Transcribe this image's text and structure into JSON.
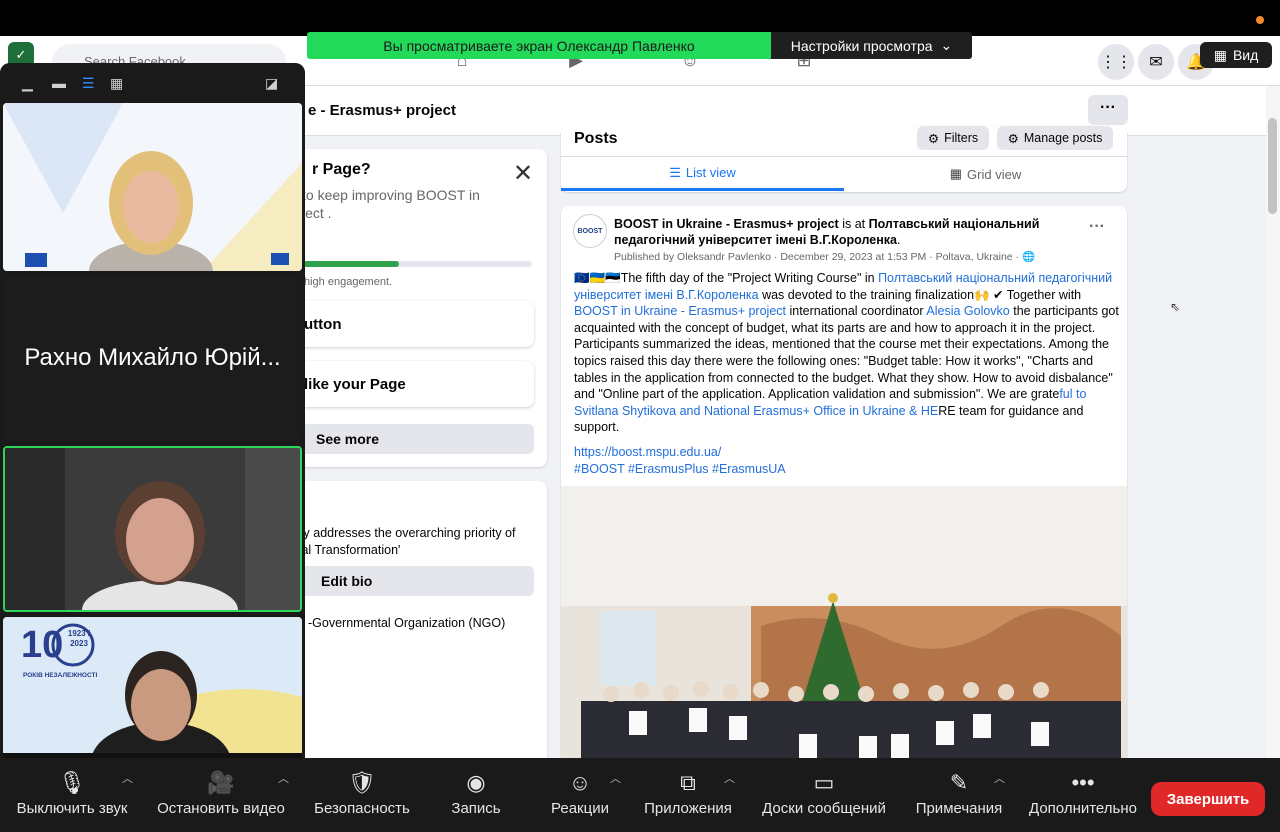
{
  "zoom": {
    "share_banner": "Вы просматриваете экран Олександр Павленко",
    "view_settings": "Настройки просмотра",
    "view_button": "Вид",
    "participants": [
      {
        "kind": "video",
        "desc": ""
      },
      {
        "kind": "name",
        "name": "Рахно Михайло Юрій..."
      },
      {
        "kind": "video",
        "desc": ""
      },
      {
        "kind": "video",
        "desc": "",
        "badge_years": "1923 / 2023",
        "badge_text": "РОКІВ НЕЗАЛЕЖНОСТІ"
      }
    ],
    "toolbar": [
      {
        "label": "Выключить звук",
        "icon": "microphone-icon",
        "glyph": "🎙"
      },
      {
        "label": "Остановить видео",
        "icon": "camera-icon",
        "glyph": "🎥"
      },
      {
        "label": "Безопасность",
        "icon": "shield-icon",
        "glyph": "🛡"
      },
      {
        "label": "Запись",
        "icon": "record-icon",
        "glyph": "◉"
      },
      {
        "label": "Реакции",
        "icon": "smile-icon",
        "glyph": "☺"
      },
      {
        "label": "Приложения",
        "icon": "apps-icon",
        "glyph": "⧉"
      },
      {
        "label": "Доски сообщений",
        "icon": "whiteboard-icon",
        "glyph": "▭"
      },
      {
        "label": "Примечания",
        "icon": "notes-icon",
        "glyph": "✎"
      },
      {
        "label": "Дополнительно",
        "icon": "more-icon",
        "glyph": "•••"
      }
    ],
    "end_button": "Завершить"
  },
  "facebook": {
    "search_placeholder": "Search Facebook",
    "page_title": "e - Erasmus+ project",
    "more": "···",
    "left_card1": {
      "title": "r Page?",
      "text": "to keep improving BOOST in\nject .",
      "engagement": "high engagement.",
      "row1": "utton",
      "row2": "like your Page",
      "see_more": "See more"
    },
    "left_card2": {
      "text": "ily addresses the overarching priority of\ntal Transformation'",
      "edit_bio": "Edit bio",
      "category": "-Governmental Organization (NGO)"
    },
    "posts": {
      "title": "Posts",
      "filters": "Filters",
      "manage": "Manage posts",
      "list_view": "List view",
      "grid_view": "Grid view"
    },
    "post": {
      "avatar_text": "BOOST",
      "author": "BOOST in Ukraine - Erasmus+ project",
      "is_at": " is at ",
      "place": "Полтавський національний педагогічний університет імені В.Г.Короленка",
      "meta": "Published by Oleksandr Pavlenko · December 29, 2023 at 1:53 PM · Poltava, Ukraine ·",
      "p1": "🇪🇺🇺🇦🇪🇪The fifth day of the \"Project Writing Course\" in ",
      "p1_link": "Полтавський національний педагогічний університет імені В.Г.Короленка",
      "p2": " was devoted to the training finalization🙌 ✔ Together with ",
      "p2_link": "BOOST in Ukraine - Erasmus+ project",
      "p3": "  international coordinator ",
      "p3_link": "Alesia Golovko",
      "p4": " the participants got acquainted with the concept of budget, what its parts are and how to approach it in the project. Participants summarized the ideas, mentioned that the course met their expectations. Among the topics raised this day there were the following ones: \"Budget table: How it works\", \"Charts and tables in the application from connected to the budget. What they show. How to avoid disbalance\" and \"Online part of the application. Application validation and submission\". We are grate",
      "p4_link": "ful to Svitlana Shytikova and National Erasmus+ Office in Ukraine & HE",
      "p5": "RE team for guidance and support.",
      "url": "https://boost.mspu.edu.ua/",
      "tags": "#BOOST #ErasmusPlus #ErasmusUA"
    }
  }
}
